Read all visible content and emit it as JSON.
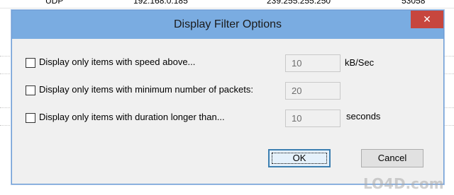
{
  "background_list": {
    "rows": [
      {
        "protocol": "UDP",
        "source": "192.168.0.185",
        "destination": "239.255.255.250",
        "port": "53058"
      }
    ]
  },
  "dialog": {
    "title": "Display Filter Options",
    "close_glyph": "✕",
    "filters": [
      {
        "label": "Display only items with speed above...",
        "value": "10",
        "unit": "kB/Sec",
        "checked": false
      },
      {
        "label": "Display only items with minimum number of packets:",
        "value": "20",
        "unit": "",
        "checked": false
      },
      {
        "label": "Display only items with duration longer than...",
        "value": "10",
        "unit": "seconds",
        "checked": false
      }
    ],
    "ok_label": "OK",
    "cancel_label": "Cancel"
  },
  "watermark": {
    "text": "LO4D.com"
  },
  "colors": {
    "titlebar": "#7aace1",
    "close_button": "#c7463e",
    "dialog_bg": "#f0f0f0",
    "default_button_border": "#3c7fb1"
  }
}
